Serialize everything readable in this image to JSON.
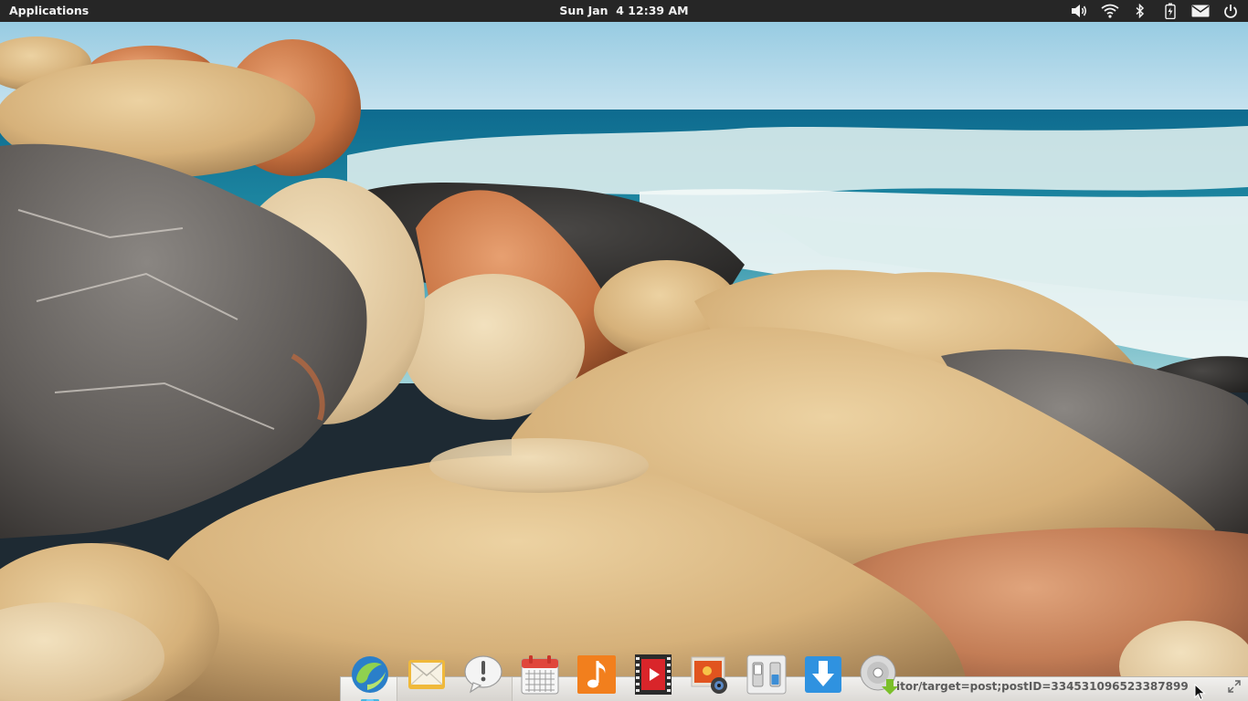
{
  "panel": {
    "applications_label": "Applications",
    "clock": "Sun Jan  4 12:39 AM",
    "indicators": [
      "volume-icon",
      "wifi-icon",
      "bluetooth-icon",
      "battery-icon",
      "mail-icon",
      "power-icon"
    ]
  },
  "dock": {
    "items": [
      {
        "name": "browser",
        "icon": "midori-browser-icon",
        "running": true
      },
      {
        "name": "mail",
        "icon": "mail-client-icon",
        "running": false
      },
      {
        "name": "notifications",
        "icon": "speech-bubble-alert-icon",
        "running": false
      },
      {
        "name": "calendar",
        "icon": "calendar-icon",
        "running": false
      },
      {
        "name": "music",
        "icon": "music-note-icon",
        "running": false
      },
      {
        "name": "videos",
        "icon": "film-strip-play-icon",
        "running": false
      },
      {
        "name": "photos",
        "icon": "photo-camera-icon",
        "running": false
      },
      {
        "name": "system-settings",
        "icon": "toggle-switches-icon",
        "running": false
      },
      {
        "name": "software-center",
        "icon": "download-arrow-icon",
        "running": false
      },
      {
        "name": "disc-installer",
        "icon": "disc-download-icon",
        "running": false
      }
    ]
  },
  "browser_window": {
    "url_text": "itor/target=post;postID=3345310965233878991"
  },
  "colors": {
    "panel_bg": "#262626",
    "panel_text": "#f2f2f2",
    "running_indicator": "#6fd0ff"
  }
}
